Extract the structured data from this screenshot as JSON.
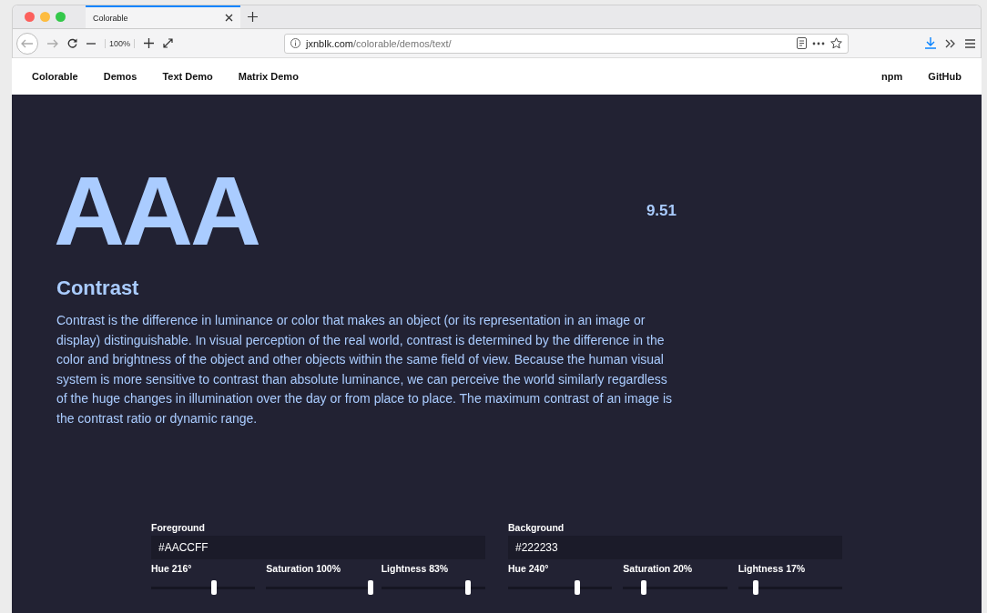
{
  "browser": {
    "tab": {
      "title": "Colorable",
      "selected": true
    },
    "zoom": "100%",
    "url_host": "jxnblk.com",
    "url_path": "/colorable/demos/text/"
  },
  "nav": {
    "left": [
      "Colorable",
      "Demos",
      "Text Demo",
      "Matrix Demo"
    ],
    "right": [
      "npm",
      "GitHub"
    ]
  },
  "hero": {
    "rating": "AAA",
    "ratio": "9.51",
    "heading": "Contrast",
    "body": "Contrast is the difference in luminance or color that makes an object (or its representation in an image or display) distinguishable. In visual perception of the real world, contrast is determined by the difference in the color and brightness of the object and other objects within the same field of view. Because the human visual system is more sensitive to contrast than absolute luminance, we can perceive the world similarly regardless of the huge changes in illumination over the day or from place to place. The maximum contrast of an image is the contrast ratio or dynamic range."
  },
  "panels": [
    {
      "label": "Foreground",
      "value": "#AACCFF",
      "sliders": [
        {
          "label": "Hue 216°",
          "level": 0.6
        },
        {
          "label": "Saturation 100%",
          "level": 1.0
        },
        {
          "label": "Lightness 83%",
          "level": 0.83
        }
      ]
    },
    {
      "label": "Background",
      "value": "#222233",
      "sliders": [
        {
          "label": "Hue 240°",
          "level": 0.667
        },
        {
          "label": "Saturation 20%",
          "level": 0.2
        },
        {
          "label": "Lightness 17%",
          "level": 0.17
        }
      ]
    }
  ]
}
